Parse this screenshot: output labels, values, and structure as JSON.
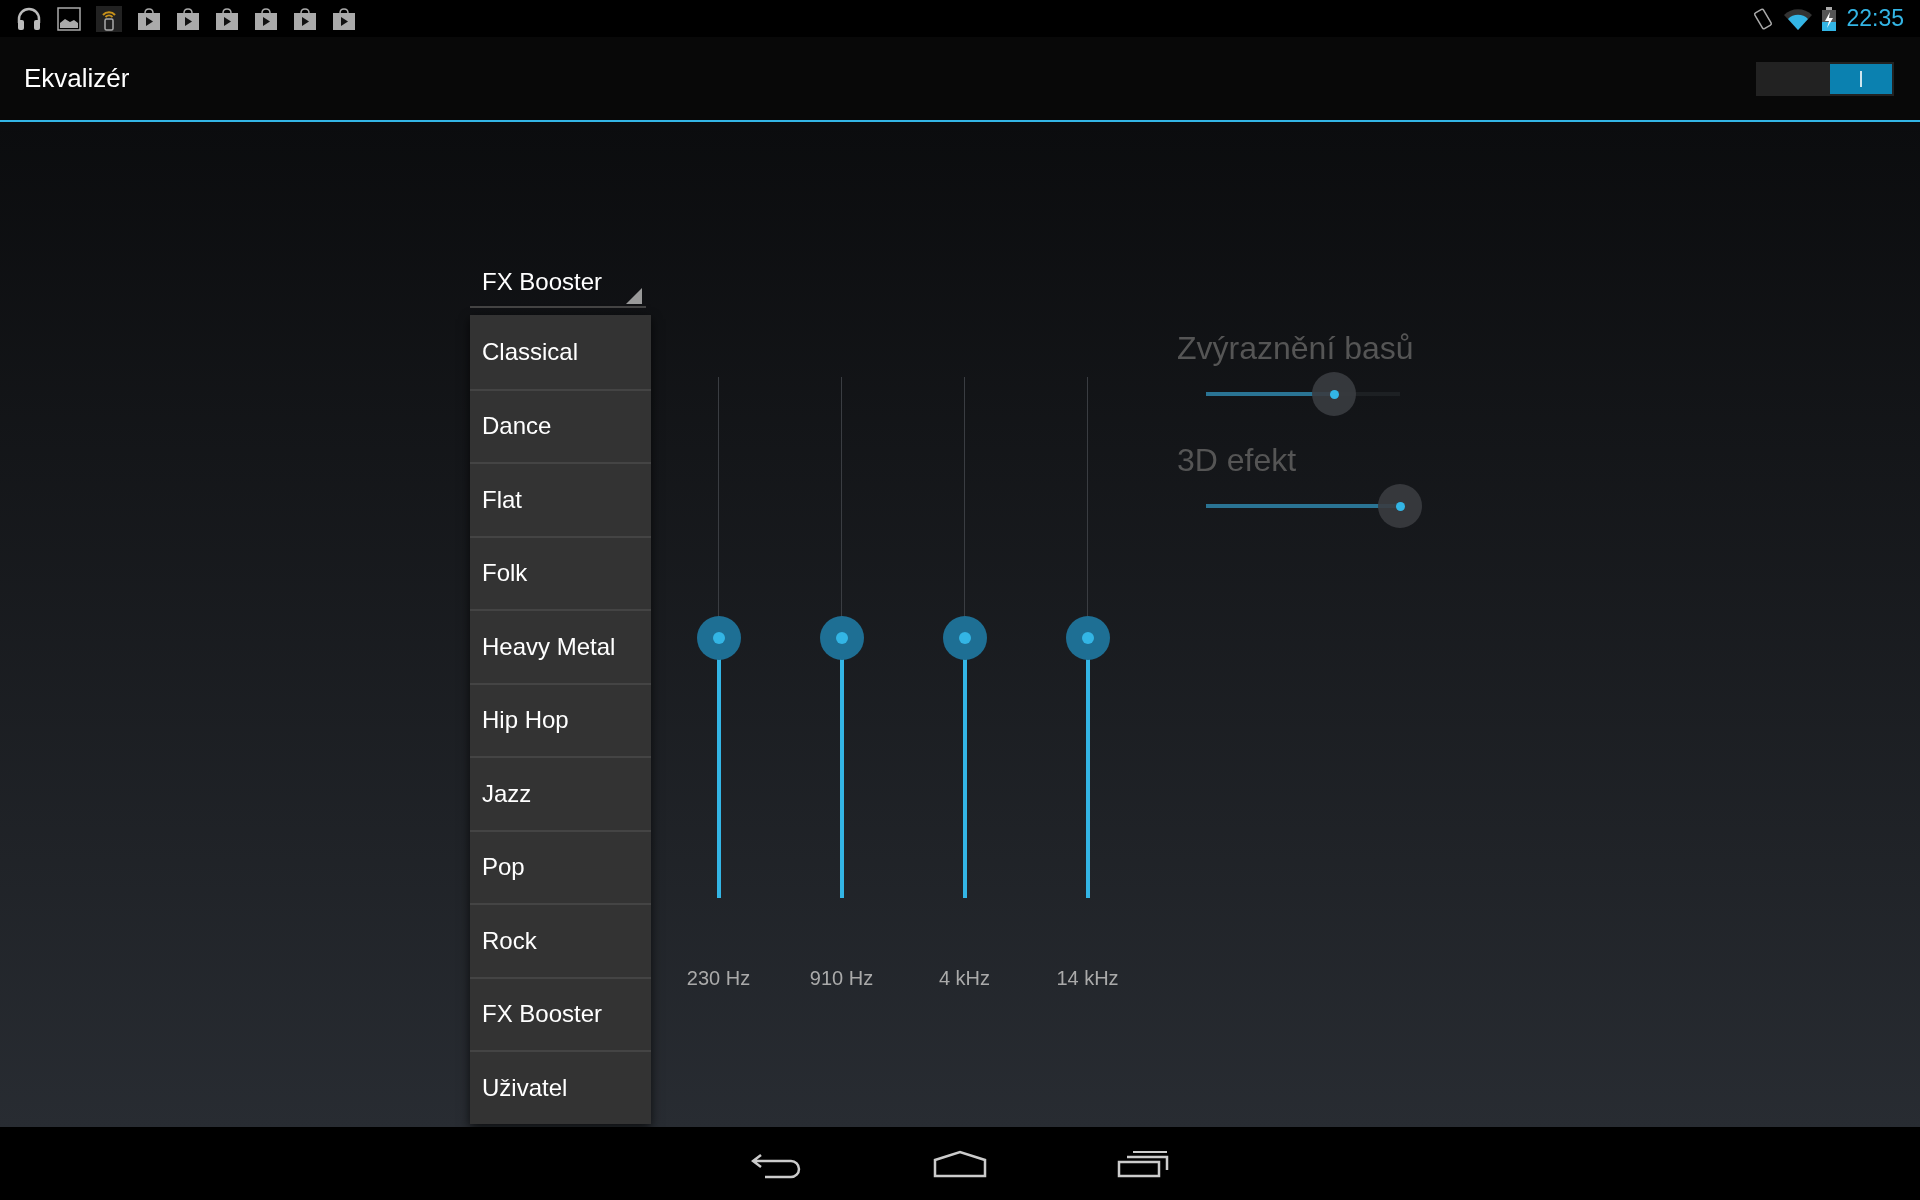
{
  "status_bar": {
    "time": "22:35"
  },
  "action_bar": {
    "title": "Ekvalizér",
    "toggle": {
      "on": true
    }
  },
  "preset_spinner": {
    "value": "FX Booster"
  },
  "preset_menu": [
    {
      "label": "Classical"
    },
    {
      "label": "Dance"
    },
    {
      "label": "Flat"
    },
    {
      "label": "Folk"
    },
    {
      "label": "Heavy Metal"
    },
    {
      "label": "Hip Hop"
    },
    {
      "label": "Jazz"
    },
    {
      "label": "Pop"
    },
    {
      "label": "Rock"
    },
    {
      "label": "FX Booster"
    },
    {
      "label": "Uživatel"
    }
  ],
  "bands": [
    {
      "label": "230 Hz",
      "level": 0.5
    },
    {
      "label": "910 Hz",
      "level": 0.5
    },
    {
      "label": "4 kHz",
      "level": 0.5
    },
    {
      "label": "14 kHz",
      "level": 0.5
    }
  ],
  "effects": [
    {
      "label": "Zvýraznění basů",
      "level": 0.66
    },
    {
      "label": "3D efekt",
      "level": 1.0
    }
  ]
}
